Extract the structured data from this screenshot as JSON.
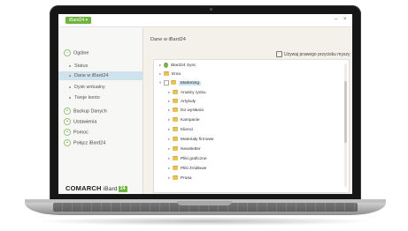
{
  "window": {
    "app_badge": "iBard24 ▾",
    "minimize": "–",
    "close": "×"
  },
  "sidebar": {
    "items": [
      {
        "label": "Ogólne",
        "kind": "group",
        "expanded": true
      },
      {
        "label": "Status",
        "kind": "sub"
      },
      {
        "label": "Dane w iBard24",
        "kind": "sub",
        "active": true
      },
      {
        "label": "Dysk wirtualny",
        "kind": "sub"
      },
      {
        "label": "Twoje konto",
        "kind": "sub"
      },
      {
        "label": "Backup Danych",
        "kind": "group"
      },
      {
        "label": "Ustawienia",
        "kind": "group"
      },
      {
        "label": "Pomoc",
        "kind": "group"
      },
      {
        "label": "Połącz iBard24",
        "kind": "group"
      }
    ],
    "logo": {
      "brand": "COMARCH",
      "product": "iBard",
      "mark": "24"
    }
  },
  "main": {
    "title": "Dane w iBard24",
    "hint": "Używaj prawego przycisku myszy",
    "tree": [
      {
        "label": "iBard24 Sync",
        "level": 0,
        "icon": "cloud-folder-icon"
      },
      {
        "label": "Ema",
        "level": 0,
        "icon": "folder-icon"
      },
      {
        "label": "Marketing",
        "level": 0,
        "icon": "folder-icon",
        "selected": true,
        "expanded": true
      },
      {
        "label": "Analizy rynku",
        "level": 1,
        "icon": "folder-icon"
      },
      {
        "label": "Artykuły",
        "level": 1,
        "icon": "folder-icon"
      },
      {
        "label": "Do wysłania",
        "level": 1,
        "icon": "folder-icon"
      },
      {
        "label": "Kampanie",
        "level": 1,
        "icon": "folder-icon"
      },
      {
        "label": "Klienci",
        "level": 1,
        "icon": "folder-icon"
      },
      {
        "label": "Materiały firmowe",
        "level": 1,
        "icon": "folder-icon"
      },
      {
        "label": "Newsletter",
        "level": 1,
        "icon": "folder-icon"
      },
      {
        "label": "Pliki graficzne",
        "level": 1,
        "icon": "folder-icon"
      },
      {
        "label": "Pliki źródłowe",
        "level": 1,
        "icon": "folder-icon"
      },
      {
        "label": "Prasa",
        "level": 1,
        "icon": "folder-icon"
      }
    ]
  }
}
